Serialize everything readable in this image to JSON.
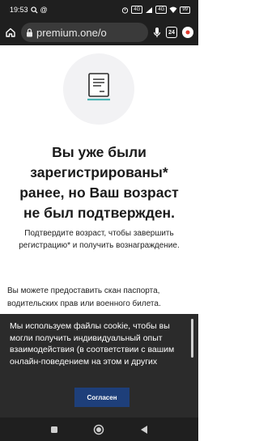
{
  "status_bar": {
    "time": "19:53",
    "battery": "99",
    "icons": [
      "search-icon",
      "at-icon",
      "alarm-icon",
      "volte-icon",
      "signal-icon",
      "wifi-icon",
      "battery-icon"
    ]
  },
  "browser": {
    "url": "premium.one/o",
    "tab_count": "24",
    "icons": [
      "home-icon",
      "lock-icon",
      "mic-icon",
      "tabs-icon",
      "menu-icon"
    ]
  },
  "content": {
    "icon": "document-icon",
    "heading": "Вы уже были зарегистрированы* ранее, но Ваш возраст не был подтвержден.",
    "subtext": "Подтвердите возраст, чтобы завершить регистрацию* и получить вознаграждение.",
    "info": "Вы можете предоставить скан паспорта, водительских прав или военного билета."
  },
  "cookie_banner": {
    "text": "Мы используем файлы cookie, чтобы вы могли получить индивидуальный опыт взаимодействия (в соответствии с вашим онлайн-поведением на этом и других",
    "accept_label": "Согласен"
  },
  "nav": {
    "icons": [
      "recent-apps-icon",
      "home-nav-icon",
      "back-icon"
    ]
  },
  "colors": {
    "accent_teal": "#4bb3b3",
    "button_blue": "#1e3f7a",
    "banner_bg": "#2b2b2b"
  }
}
